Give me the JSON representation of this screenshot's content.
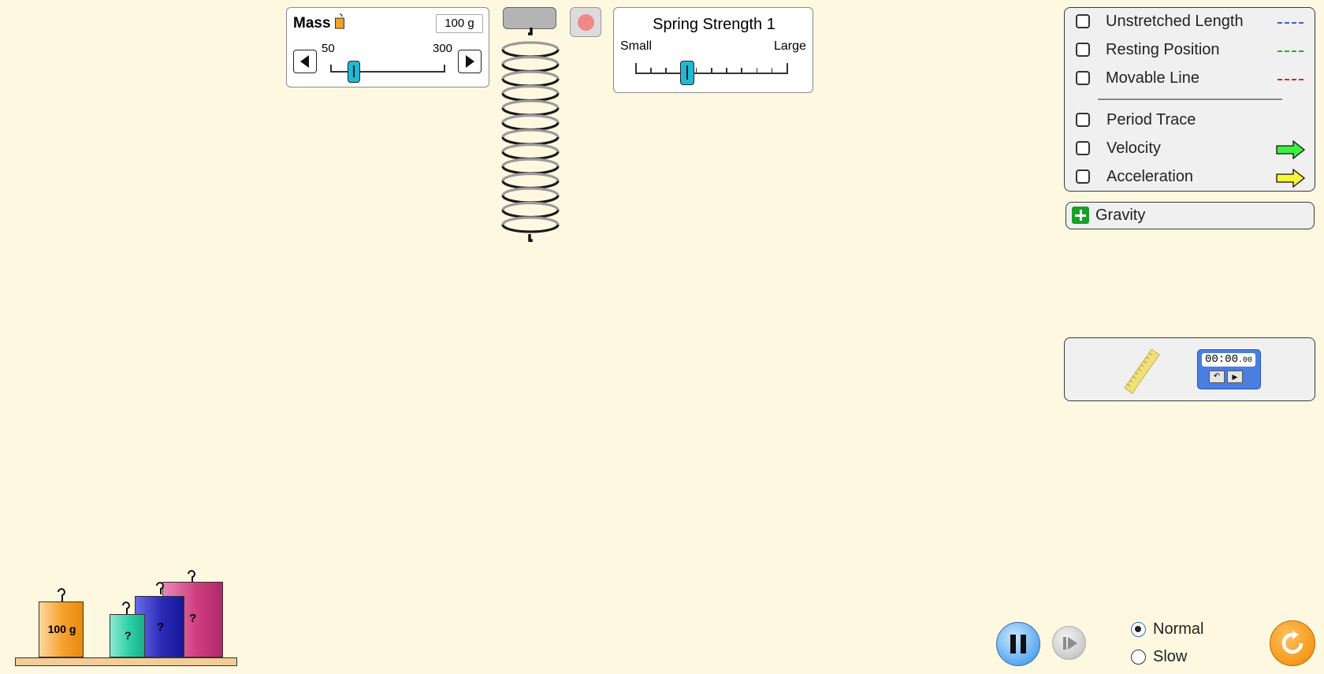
{
  "mass_panel": {
    "title": "Mass",
    "value": "100 g",
    "min_label": "50",
    "max_label": "300",
    "slider_value": 100,
    "slider_min": 50,
    "slider_max": 300
  },
  "spring_panel": {
    "title": "Spring Strength 1",
    "small_label": "Small",
    "large_label": "Large"
  },
  "options_panel": {
    "items": [
      {
        "label": "Unstretched Length",
        "checked": false,
        "line_color": "#3b5bdb"
      },
      {
        "label": "Resting Position",
        "checked": false,
        "line_color": "#1fb51f"
      },
      {
        "label": "Movable Line",
        "checked": false,
        "line_color": "#e81f1f"
      },
      {
        "label": "Period Trace",
        "checked": false
      },
      {
        "label": "Velocity",
        "checked": false,
        "arrow_color": "#3ef03e"
      },
      {
        "label": "Acceleration",
        "checked": false,
        "arrow_color": "#f5f53a"
      }
    ]
  },
  "gravity_panel": {
    "label": "Gravity",
    "icon": "plus-expand-icon"
  },
  "tools": {
    "ruler_icon": "ruler-icon",
    "stopwatch_time": "00:00",
    "stopwatch_hundredths": ".00"
  },
  "masses": {
    "known_label": "100 g",
    "unknown_label": "?",
    "colors": {
      "known": "#f5a02a",
      "teal": "#2fd0a8",
      "blue": "#2a2ab8",
      "pink": "#d04080"
    }
  },
  "playback": {
    "speed_options": [
      {
        "label": "Normal",
        "selected": true
      },
      {
        "label": "Slow",
        "selected": false
      }
    ],
    "pause_icon": "pause-icon",
    "step_icon": "step-forward-icon",
    "reset_icon": "reset-icon"
  }
}
